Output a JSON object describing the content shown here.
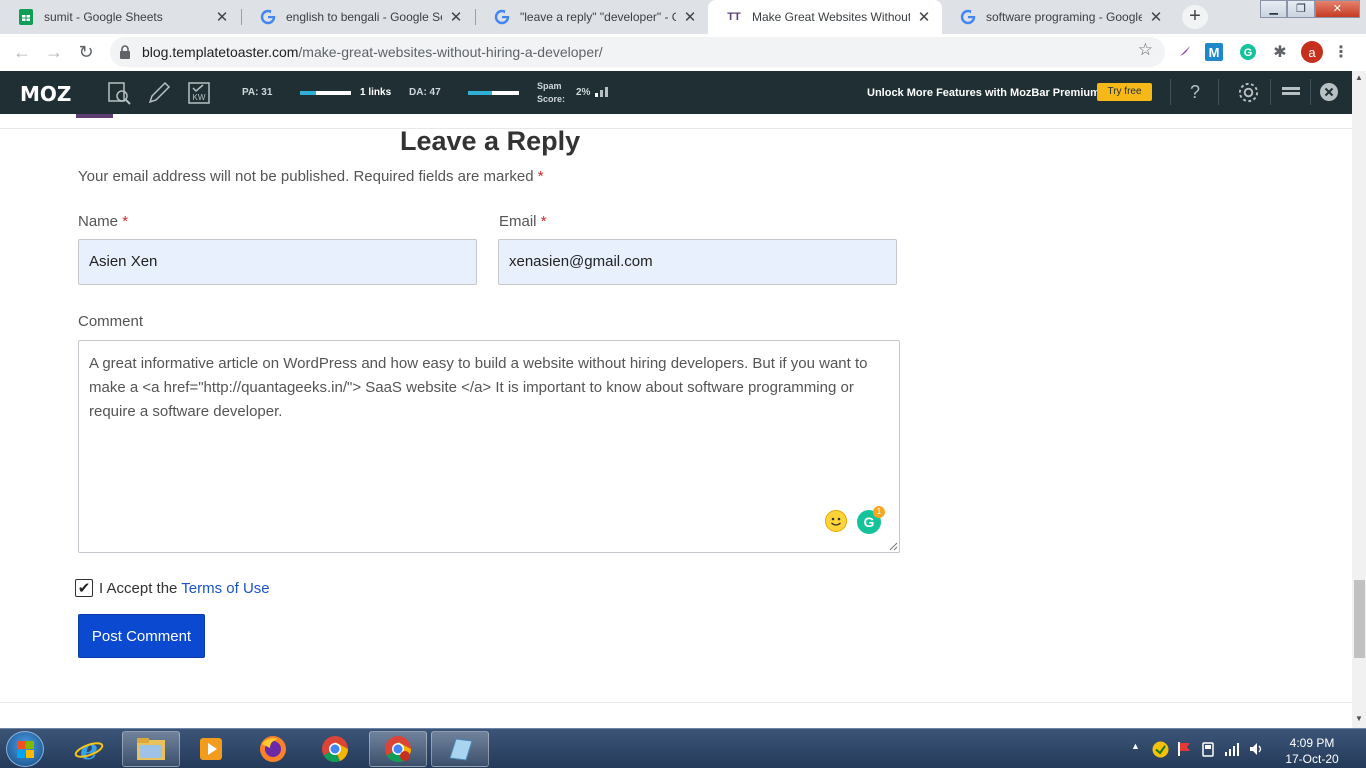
{
  "browser": {
    "tabs": [
      {
        "title": "sumit - Google Sheets",
        "icon": "google-sheets-icon"
      },
      {
        "title": "english to bengali - Google Sea",
        "icon": "google-icon"
      },
      {
        "title": "\"leave a reply\" \"developer\" - Go",
        "icon": "google-icon"
      },
      {
        "title": "Make Great Websites Without H",
        "icon": "templatetoaster-icon",
        "active": true
      },
      {
        "title": "software programing - Google S",
        "icon": "google-icon"
      }
    ],
    "url_domain": "blog.templatetoaster.com",
    "url_path": "/make-great-websites-without-hiring-a-developer/",
    "profile_initial": "a"
  },
  "mozbar": {
    "logo": "MOZ",
    "pa": "PA: 31",
    "links": "1 links",
    "da": "DA: 47",
    "spam_label_1": "Spam",
    "spam_label_2": "Score:",
    "spam_value": "2%",
    "unlock_text": "Unlock More Features with MozBar Premium",
    "try_free": "Try free",
    "help": "?",
    "pa_fraction": 0.31,
    "da_fraction": 0.47
  },
  "form": {
    "heading": "Leave a Reply",
    "notice": "Your email address will not be published. Required fields are marked",
    "required_mark": "*",
    "name_label": "Name",
    "name_value": "Asien Xen",
    "email_label": "Email",
    "email_value": "xenasien@gmail.com",
    "comment_label": "Comment",
    "comment_value": "A great informative article on WordPress and how easy to build a website without hiring developers. But if you want to make a <a href=\"http://quantageeks.in/\"> SaaS website </a> It is important to know about software programming or require a software developer.",
    "grammarly_count": "1",
    "accept_prefix": "I Accept the",
    "terms_link": "Terms of Use",
    "accept_checked": true,
    "submit_label": "Post Comment"
  },
  "taskbar": {
    "time": "4:09 PM",
    "date": "17-Oct-20"
  },
  "colors": {
    "accent_button": "#0b49d1",
    "link": "#1a55c4",
    "required": "#d02a2a",
    "mozbar_bg": "#1f2f33",
    "autofill_bg": "#e8f0fe"
  }
}
